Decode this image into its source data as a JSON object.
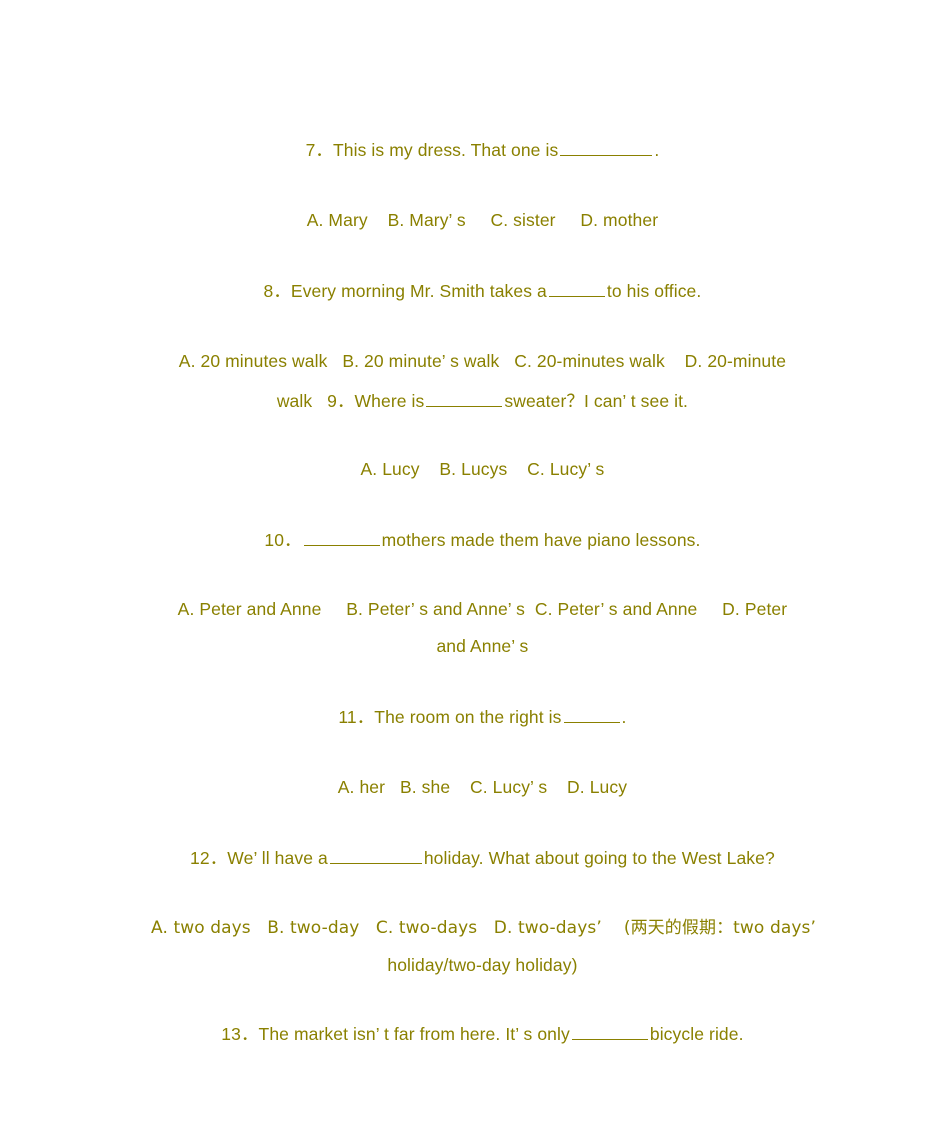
{
  "document": {
    "type": "grammar-exercise-worksheet",
    "text_color": "#8a8000",
    "background_color": "#ffffff"
  },
  "questions": [
    {
      "number": "7．",
      "stem_before": "This is my dress. That one is ",
      "stem_after": ".",
      "blank_size": "b-xl",
      "options_line": "A. Mary    B. Mary’ s     C. sister     D. mother"
    },
    {
      "number": "8．",
      "stem_before": "Every morning Mr. Smith takes a ",
      "stem_after": " to his office.",
      "blank_size": "b-sm",
      "options_line": "A. 20 minutes walk   B. 20 minute’ s walk   C. 20-minutes walk    D. 20-minute walk"
    },
    {
      "number": "9．",
      "stem_before": "Where is ",
      "stem_after": " sweater？I can’ t see it.",
      "blank_size": "b-lg",
      "options_line": "A. Lucy    B. Lucys    C. Lucy’ s"
    },
    {
      "number": "10．",
      "stem_before": " ",
      "stem_after": " mothers made them have piano lessons.",
      "blank_size": "b-lg",
      "options_line": "A. Peter and Anne     B. Peter’ s and Anne’ s  C. Peter’ s and Anne     D. Peter and Anne’ s"
    },
    {
      "number": "11．",
      "stem_before": "The room on the right is ",
      "stem_after": ".",
      "blank_size": "b-sm",
      "options_line": "A. her   B. she    C. Lucy’ s    D. Lucy"
    },
    {
      "number": "12．",
      "stem_before": "We’ ll have a ",
      "stem_after": " holiday. What about going to the West Lake?",
      "blank_size": "b-xl",
      "options_line": "A. two days   B. two-day   C. two-days   D. two-days’    (两天的假期：two days’ holiday/two-day holiday)"
    },
    {
      "number": "13．",
      "stem_before": "The market isn’ t far from here. It’ s only ",
      "stem_after": " bicycle ride.",
      "blank_size": "b-lg",
      "options_line": ""
    }
  ],
  "lines": {
    "q7_stem": "7．This is my dress. That one is",
    "q7_tail": ".",
    "q7_options": "A. Mary    B. Mary’ s     C. sister     D. mother",
    "q8_stem": "8．Every morning Mr. Smith takes a",
    "q8_tail": "to his office.",
    "q8_options_a": "A. 20 minutes walk   B. 20 minute’ s walk   C. 20-minutes walk    D. 20-minute",
    "q8_options_b_prefix": "walk   9．Where is",
    "q9_tail": "sweater？I can’ t see it.",
    "q9_options": "A. Lucy    B. Lucys    C. Lucy’ s",
    "q10_number": "10．",
    "q10_tail": "mothers made them have piano lessons.",
    "q10_options_a": "A. Peter and Anne     B. Peter’ s and Anne’ s  C. Peter’ s and Anne     D. Peter",
    "q10_options_b": "and Anne’ s",
    "q11_stem": "11．The room on the right is",
    "q11_tail": ".",
    "q11_options": "A. her   B. she    C. Lucy’ s    D. Lucy",
    "q12_stem": "12．We’ ll have a",
    "q12_tail": "holiday. What about going to the West Lake?",
    "q12_options_a": "A. two days   B. two-day   C. two-days   D. two-days’    (两天的假期：two days’",
    "q12_options_b": "holiday/two-day holiday)",
    "q13_stem": "13．The market isn’ t far from here. It’ s only",
    "q13_tail": "bicycle ride."
  }
}
